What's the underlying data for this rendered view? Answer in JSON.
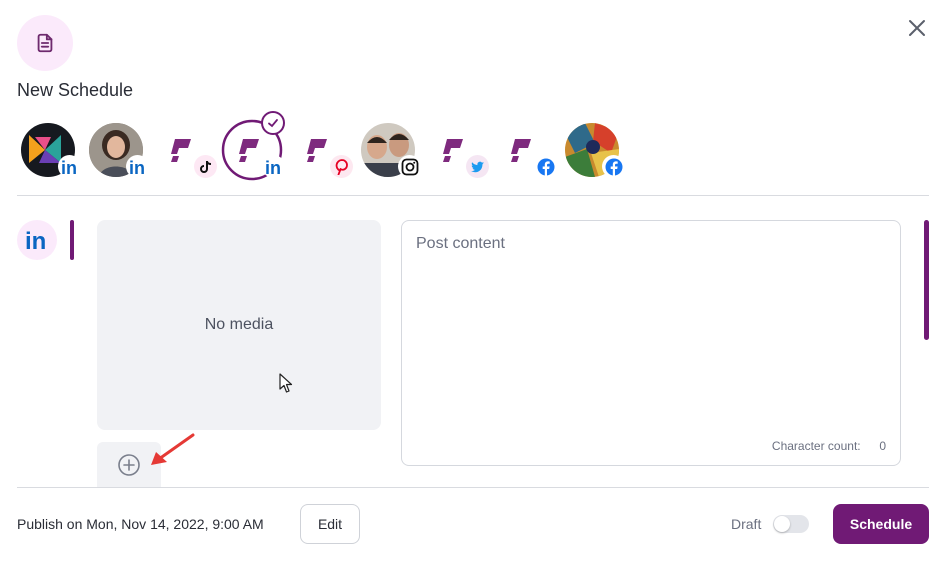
{
  "dialog": {
    "title": "New Schedule",
    "header_icon": "document-icon",
    "close_icon": "close-icon"
  },
  "accounts": [
    {
      "name": "account-1",
      "network": "linkedin",
      "avatar": "brand-logo",
      "selected": false
    },
    {
      "name": "account-2",
      "network": "linkedin",
      "avatar": "person-photo",
      "selected": false
    },
    {
      "name": "account-3",
      "network": "tiktok",
      "avatar": "brand-mark",
      "selected": false
    },
    {
      "name": "account-4",
      "network": "linkedin",
      "avatar": "brand-mark",
      "selected": true
    },
    {
      "name": "account-5",
      "network": "pinterest",
      "avatar": "brand-mark",
      "selected": false
    },
    {
      "name": "account-6",
      "network": "instagram",
      "avatar": "group-photo",
      "selected": false
    },
    {
      "name": "account-7",
      "network": "twitter",
      "avatar": "brand-mark",
      "selected": false
    },
    {
      "name": "account-8",
      "network": "facebook",
      "avatar": "brand-mark",
      "selected": false
    },
    {
      "name": "account-9",
      "network": "facebook",
      "avatar": "painting-photo",
      "selected": false
    }
  ],
  "editor": {
    "network_icon": "linkedin-icon",
    "media_placeholder": "No media",
    "add_media_icon": "plus-circle-icon",
    "post_placeholder": "Post content",
    "char_count_label": "Character count:",
    "char_count_value": "0"
  },
  "footer": {
    "publish_text": "Publish on Mon, Nov 14, 2022, 9:00 AM",
    "edit_label": "Edit",
    "draft_label": "Draft",
    "draft_enabled": false,
    "schedule_label": "Schedule"
  },
  "colors": {
    "accent": "#701a75",
    "brand_purple": "#7e2a7e",
    "linkedin": "#0a66c2",
    "pinterest": "#e60023",
    "twitter": "#1d9bf0",
    "facebook": "#1877f2"
  }
}
